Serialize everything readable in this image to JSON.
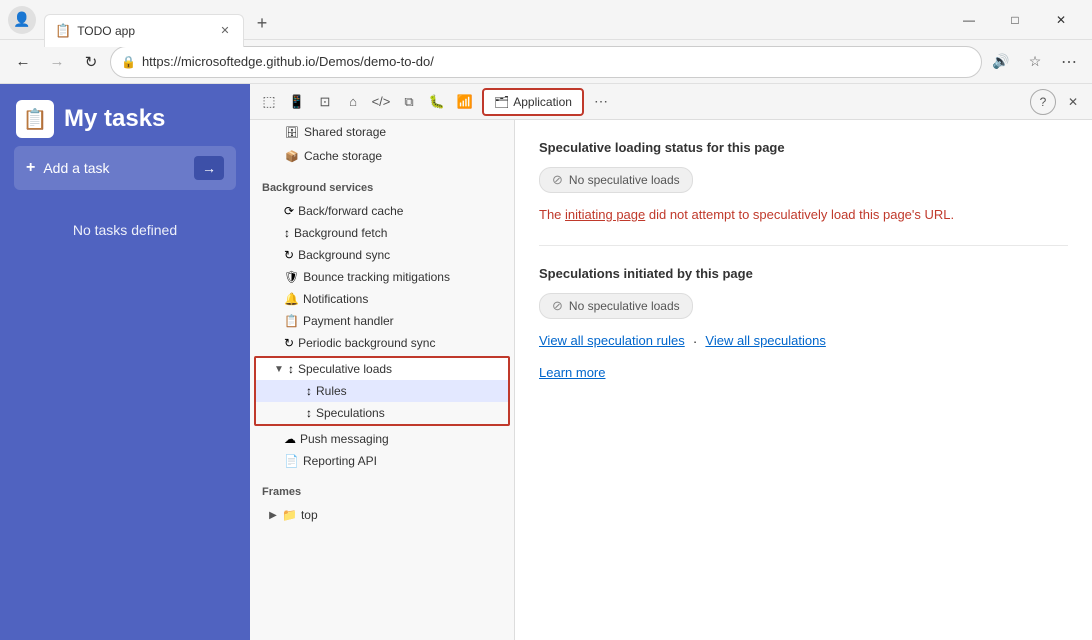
{
  "browser": {
    "tab_title": "TODO app",
    "url": "https://microsoftedge.github.io/Demos/demo-to-do/",
    "tab_icon": "📋"
  },
  "app": {
    "title": "My tasks",
    "add_task_label": "Add a task",
    "no_tasks": "No tasks defined",
    "logo_icon": "📋"
  },
  "devtools": {
    "toolbar_icons": [
      "pointer",
      "mobile",
      "toggle-sidebar",
      "home",
      "code",
      "layers",
      "bug",
      "wifi"
    ],
    "tabs": [
      {
        "id": "application",
        "label": "Application",
        "icon": "🗂",
        "active": true
      }
    ],
    "more_icon": "⋯",
    "help_icon": "?",
    "close_icon": "✕"
  },
  "sidebar": {
    "sections": [
      {
        "id": "storage-section",
        "items": [
          {
            "id": "shared-storage",
            "label": "Shared storage",
            "icon": "🗄",
            "indent": 1,
            "expandable": false
          },
          {
            "id": "cache-storage",
            "label": "Cache storage",
            "icon": "📦",
            "indent": 1,
            "expandable": false
          }
        ]
      },
      {
        "id": "background-services",
        "header": "Background services",
        "items": [
          {
            "id": "back-forward-cache",
            "label": "Back/forward cache",
            "icon": "⟳",
            "indent": 1
          },
          {
            "id": "background-fetch",
            "label": "Background fetch",
            "icon": "↕",
            "indent": 1
          },
          {
            "id": "background-sync",
            "label": "Background sync",
            "icon": "↻",
            "indent": 1
          },
          {
            "id": "bounce-tracking",
            "label": "Bounce tracking mitigations",
            "icon": "🛡",
            "indent": 1
          },
          {
            "id": "notifications",
            "label": "Notifications",
            "icon": "🔔",
            "indent": 1
          },
          {
            "id": "payment-handler",
            "label": "Payment handler",
            "icon": "📋",
            "indent": 1
          },
          {
            "id": "periodic-background-sync",
            "label": "Periodic background sync",
            "icon": "↻",
            "indent": 1
          },
          {
            "id": "speculative-loads",
            "label": "Speculative loads",
            "icon": "↕",
            "indent": 1,
            "expanded": true,
            "highlighted": true
          },
          {
            "id": "rules",
            "label": "Rules",
            "icon": "↕",
            "indent": 2,
            "child": true
          },
          {
            "id": "speculations",
            "label": "Speculations",
            "icon": "↕",
            "indent": 2,
            "child": true
          },
          {
            "id": "push-messaging",
            "label": "Push messaging",
            "icon": "☁",
            "indent": 1
          },
          {
            "id": "reporting-api",
            "label": "Reporting API",
            "icon": "📄",
            "indent": 1
          }
        ]
      },
      {
        "id": "frames-section",
        "header": "Frames",
        "items": [
          {
            "id": "frames-top",
            "label": "top",
            "icon": "📁",
            "indent": 1,
            "expandable": true
          }
        ]
      }
    ]
  },
  "main_panel": {
    "section1_title": "Speculative loading status for this page",
    "no_loads_label": "No speculative loads",
    "status_message_prefix": "The ",
    "status_message_link": "initiating page",
    "status_message_suffix": " did not attempt to speculatively load this page's URL.",
    "section2_title": "Speculations initiated by this page",
    "no_loads_label2": "No speculative loads",
    "view_all_rules_link": "View all speculation rules",
    "view_all_speculations_link": "View all speculations",
    "dot_separator": "·",
    "learn_more_link": "Learn more"
  },
  "window_controls": {
    "minimize": "—",
    "maximize": "□",
    "close": "✕"
  }
}
